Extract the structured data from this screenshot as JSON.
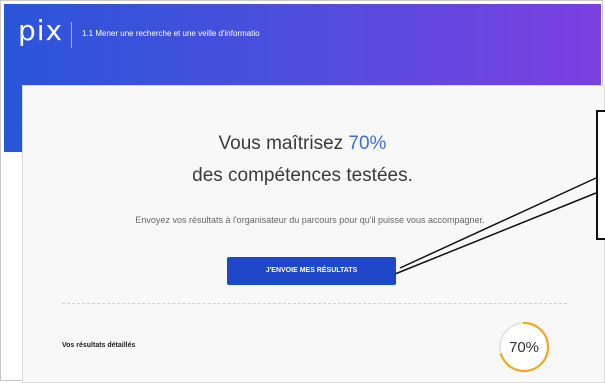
{
  "header": {
    "logo_text": "pix",
    "breadcrumb": "1.1 Mener une recherche et une veille d'informatio"
  },
  "results": {
    "title_prefix": "Vous maîtrisez ",
    "percent_text": "70%",
    "title_line2": "des compétences testées.",
    "message": "Envoyez vos résultats à l'organisateur du parcours pour qu'il puisse vous accompagner.",
    "send_button_label": "J'ENVOIE MES RÉSULTATS"
  },
  "details": {
    "label": "Vos résultats détaillés",
    "gauge_text": "70%",
    "gauge_value": 0.7
  },
  "colors": {
    "header_gradient_start": "#2a55d9",
    "header_gradient_end": "#7d3fe0",
    "button": "#1f48c8",
    "percent_accent": "#3d6fd6",
    "gauge_ring": "#f2a623"
  }
}
